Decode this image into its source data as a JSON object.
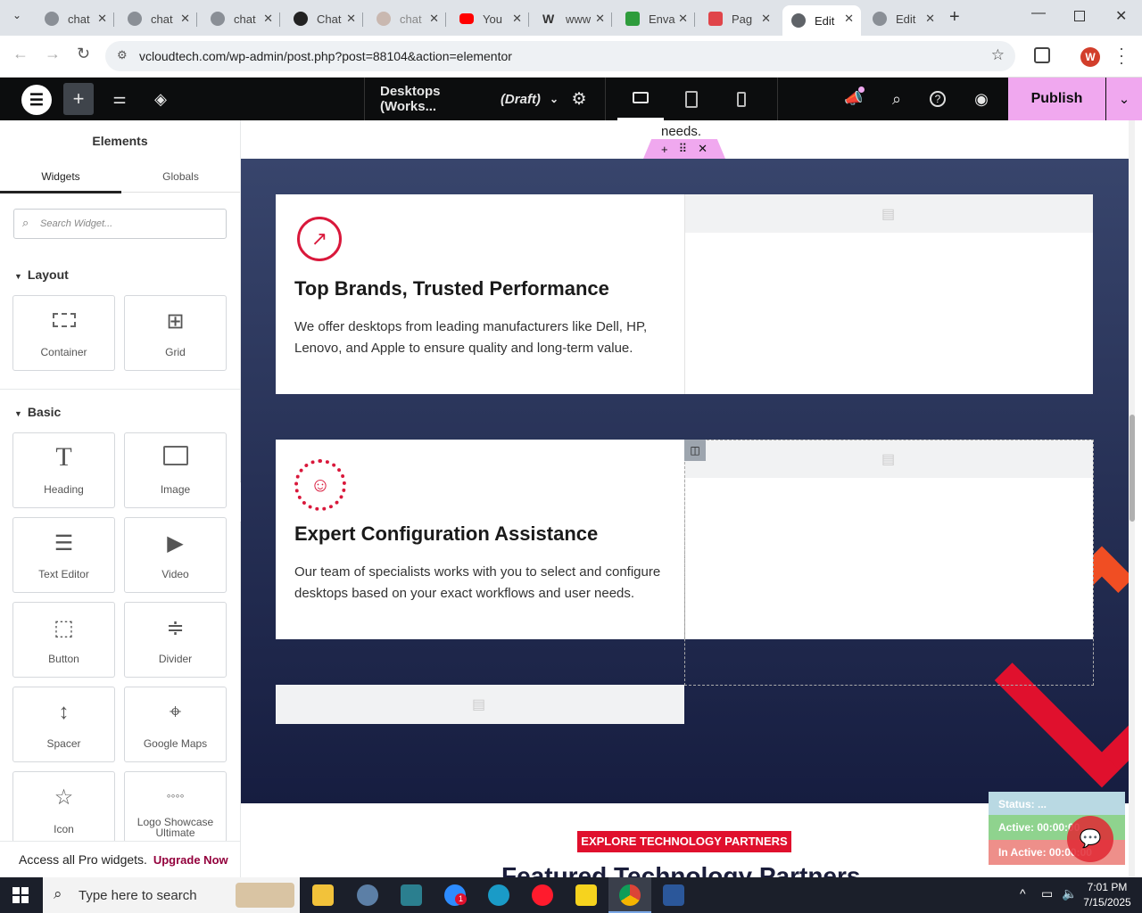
{
  "browser": {
    "tabs": [
      {
        "title": "chat"
      },
      {
        "title": "chat"
      },
      {
        "title": "chat"
      },
      {
        "title": "Chat"
      },
      {
        "title": "chat"
      },
      {
        "title": "You"
      },
      {
        "title": "www"
      },
      {
        "title": "Enva"
      },
      {
        "title": "Pag"
      },
      {
        "title": "Edit",
        "active": true
      },
      {
        "title": "Edit"
      }
    ],
    "url": "vcloudtech.com/wp-admin/post.php?post=88104&action=elementor",
    "profile_initial": "W"
  },
  "editor": {
    "page_title": "Desktops (Works...",
    "page_status": "(Draft)",
    "publish_label": "Publish"
  },
  "panel": {
    "title": "Elements",
    "tabs": [
      "Widgets",
      "Globals"
    ],
    "search_placeholder": "Search Widget...",
    "layout_label": "Layout",
    "basic_label": "Basic",
    "layout_widgets": [
      "Container",
      "Grid"
    ],
    "basic_widgets": [
      "Heading",
      "Image",
      "Text Editor",
      "Video",
      "Button",
      "Divider",
      "Spacer",
      "Google Maps",
      "Icon",
      "Logo Showcase Ultimate"
    ],
    "pro_text": "Access all Pro widgets.",
    "upgrade_label": "Upgrade Now"
  },
  "canvas": {
    "top_text": "needs.",
    "cards": [
      {
        "title": "Top Brands, Trusted Performance",
        "body": "We offer desktops from leading manufacturers like Dell, HP, Lenovo, and Apple to ensure quality and long-term value."
      },
      {
        "title": "Expert Configuration Assistance",
        "body": "Our team of specialists works with you to select and configure desktops based on your exact workflows and user needs."
      }
    ],
    "badge": "EXPLORE TECHNOLOGY PARTNERS",
    "partners_heading": "Featured Technology Partners"
  },
  "status_widget": {
    "status": "Status: ...",
    "active": "Active: 00:00:00",
    "inactive": "In Active: 00:00:00"
  },
  "taskbar": {
    "search_placeholder": "Type here to search",
    "time": "7:01 PM",
    "date": "7/15/2025",
    "zoom_badge": "1"
  }
}
